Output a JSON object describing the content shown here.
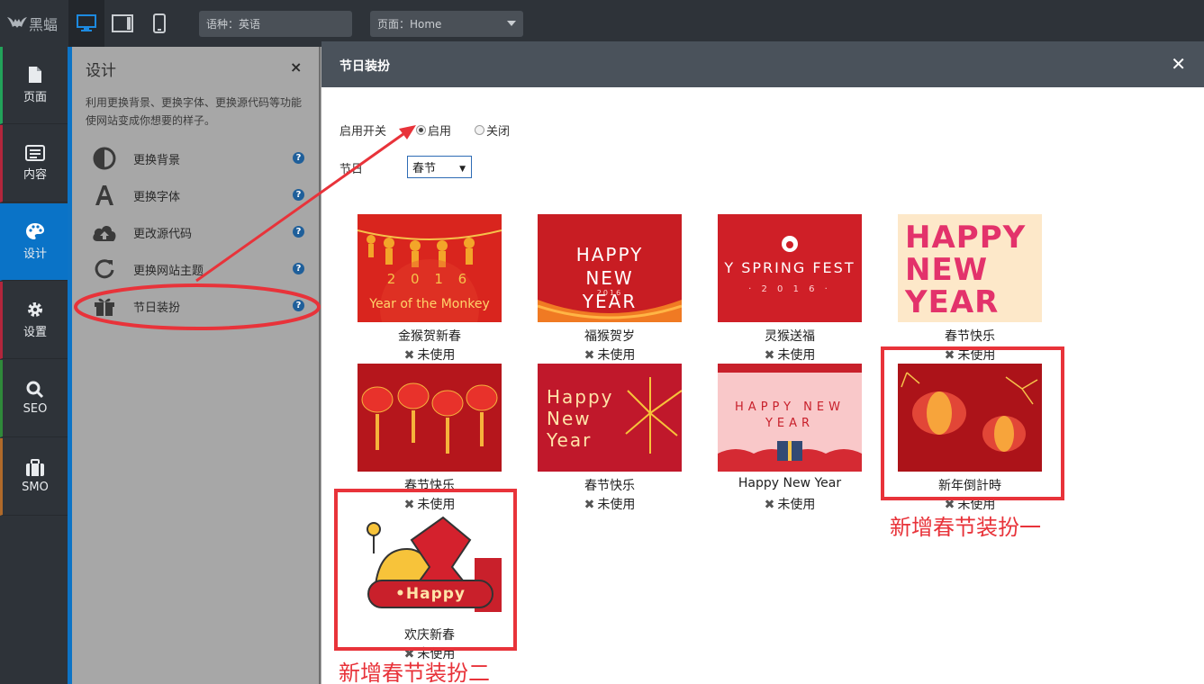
{
  "topbar": {
    "logo": "黑蝠",
    "language": "语种：英语",
    "page": "页面：Home"
  },
  "leftnav": [
    {
      "label": "页面",
      "icon": "page-icon"
    },
    {
      "label": "内容",
      "icon": "content-icon"
    },
    {
      "label": "设计",
      "icon": "palette-icon"
    },
    {
      "label": "设置",
      "icon": "gear-icon"
    },
    {
      "label": "SEO",
      "icon": "search-icon"
    },
    {
      "label": "SMO",
      "icon": "briefcase-icon"
    }
  ],
  "panel": {
    "title": "设计",
    "close": "×",
    "desc": "利用更换背景、更换字体、更换源代码等功能使网站变成你想要的样子。",
    "items": [
      {
        "label": "更换背景",
        "icon": "contrast-icon"
      },
      {
        "label": "更换字体",
        "icon": "font-icon"
      },
      {
        "label": "更改源代码",
        "icon": "cloud-upload-icon"
      },
      {
        "label": "更换网站主题",
        "icon": "refresh-icon"
      },
      {
        "label": "节日装扮",
        "icon": "gift-icon"
      }
    ],
    "help": "?"
  },
  "modal": {
    "title": "节日装扮",
    "close": "✕",
    "enable_label": "启用开关",
    "radio_on": "启用",
    "radio_off": "关闭",
    "festival_label": "节日",
    "festival_value": "春节",
    "unused": "未使用",
    "cards": [
      {
        "name": "金猴贺新春",
        "thumb_text": "Year of the Monkey",
        "thumb_year": "2 0 1 6"
      },
      {
        "name": "福猴贺岁",
        "thumb_text": "HAPPY NEW YEAR",
        "thumb_year": "2016"
      },
      {
        "name": "灵猴送福",
        "thumb_text": "Y SPRING FEST",
        "thumb_year": "· 2 0 1 6 ·"
      },
      {
        "name": "春节快乐",
        "thumb_text": "HAPPY NEW YEAR"
      },
      {
        "name": "春节快乐",
        "thumb_text": ""
      },
      {
        "name": "春节快乐",
        "thumb_text": "Happy New Year"
      },
      {
        "name": "Happy New Year",
        "thumb_text": "HAPPY NEW YEAR"
      },
      {
        "name": "新年倒計時",
        "thumb_text": ""
      },
      {
        "name": "欢庆新春",
        "thumb_text": "•Happy"
      }
    ]
  },
  "annotations": {
    "new1": "新增春节装扮一",
    "new2": "新增春节装扮二"
  }
}
